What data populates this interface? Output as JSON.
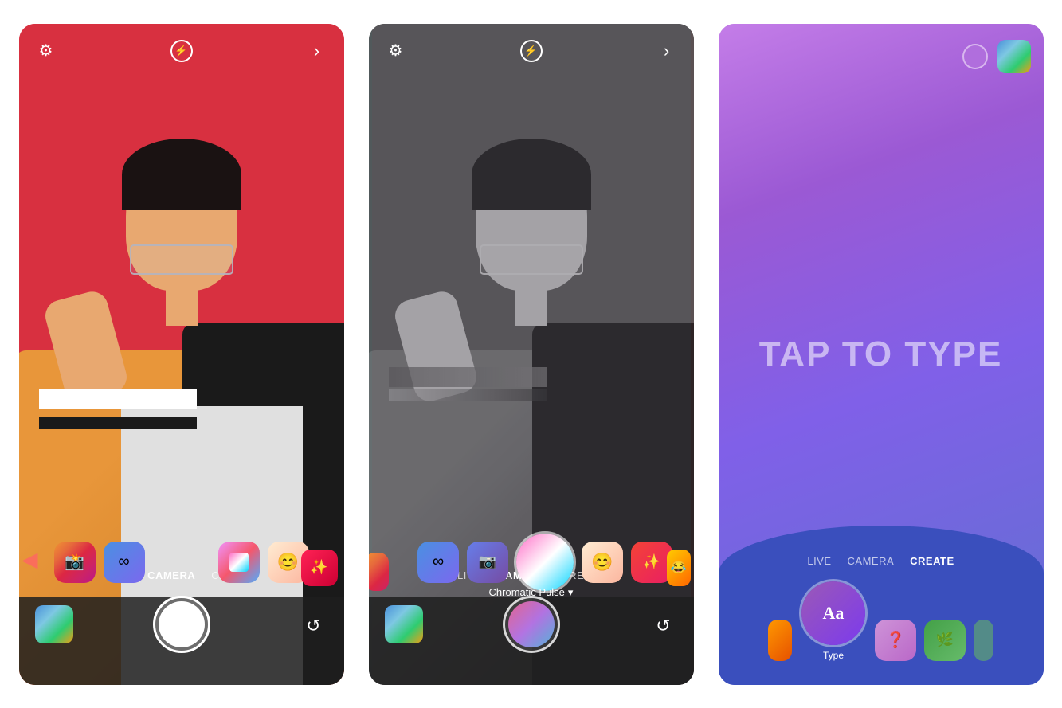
{
  "phones": [
    {
      "id": "phone1",
      "background": "pink-red",
      "top_bar": {
        "settings_icon": "gear",
        "flash_icon": "lightning",
        "forward_icon": "chevron-right"
      },
      "nav": {
        "items": [
          "LIVE",
          "CAMERA",
          "CREATE"
        ],
        "active": "CAMERA"
      },
      "filter_label": null,
      "mode": "camera",
      "effects": [
        "instagram",
        "infinity",
        "gradient",
        "emoji",
        "red-sparkle"
      ]
    },
    {
      "id": "phone2",
      "background": "grayscale",
      "top_bar": {
        "settings_icon": "gear",
        "flash_icon": "lightning",
        "forward_icon": "chevron-right"
      },
      "nav": {
        "items": [
          "LIVE",
          "CAMERA",
          "CREATE"
        ],
        "active": "CAMERA"
      },
      "filter_label": "Chromatic Pulse",
      "mode": "camera-filter",
      "effects": [
        "infinity",
        "camera-app",
        "chromatic-gradient",
        "emoji-yellow",
        "sparkle"
      ]
    },
    {
      "id": "phone3",
      "background": "purple-gradient",
      "top_bar": {
        "circle_icon": "color-circle",
        "gallery_icon": "gallery"
      },
      "nav": {
        "items": [
          "LIVE",
          "CAMERA",
          "CREATE"
        ],
        "active": "CREATE"
      },
      "tap_to_type": "TAP TO TYPE",
      "mode": "create",
      "type_label": "Type",
      "effects": [
        "question",
        "green-circle"
      ]
    }
  ],
  "nav_items": {
    "live": "LIVE",
    "camera": "CAMERA",
    "create": "CREATE"
  },
  "filter": {
    "chromatic_pulse": "Chromatic Pulse",
    "chevron": "▾"
  },
  "type_mode": {
    "label": "Type",
    "aa_text": "Aa"
  }
}
